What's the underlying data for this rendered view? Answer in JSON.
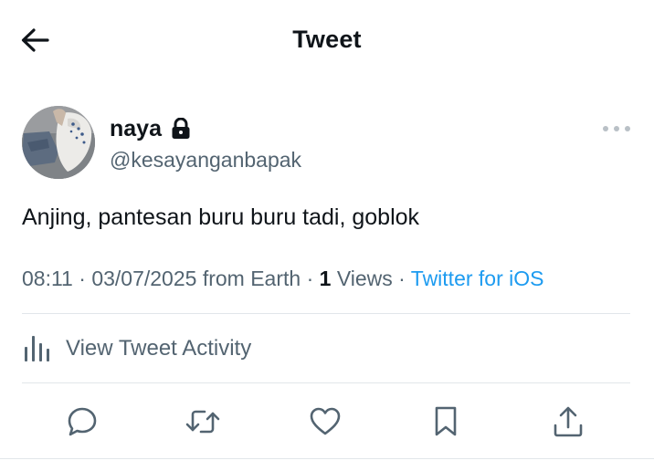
{
  "header": {
    "title": "Tweet",
    "back_icon": "arrow-left-icon"
  },
  "author": {
    "display_name": "naya",
    "handle": "@kesayanganbapak",
    "protected_icon": "lock-icon",
    "more_icon": "more-horizontal-icon"
  },
  "tweet": {
    "text": "Anjing, pantesan buru buru tadi, goblok",
    "time": "08:11",
    "date": "03/07/2025 from Earth",
    "views_count": "1",
    "views_label": "Views",
    "source": "Twitter for iOS"
  },
  "activity": {
    "label": "View Tweet Activity",
    "icon": "bar-chart-icon"
  },
  "actions": {
    "reply_icon": "reply-icon",
    "retweet_icon": "retweet-icon",
    "like_icon": "heart-icon",
    "bookmark_icon": "bookmark-icon",
    "share_icon": "share-icon"
  },
  "colors": {
    "text": "#0f1419",
    "secondary": "#536471",
    "link": "#1d9bf0",
    "divider": "#e1e6ea"
  }
}
